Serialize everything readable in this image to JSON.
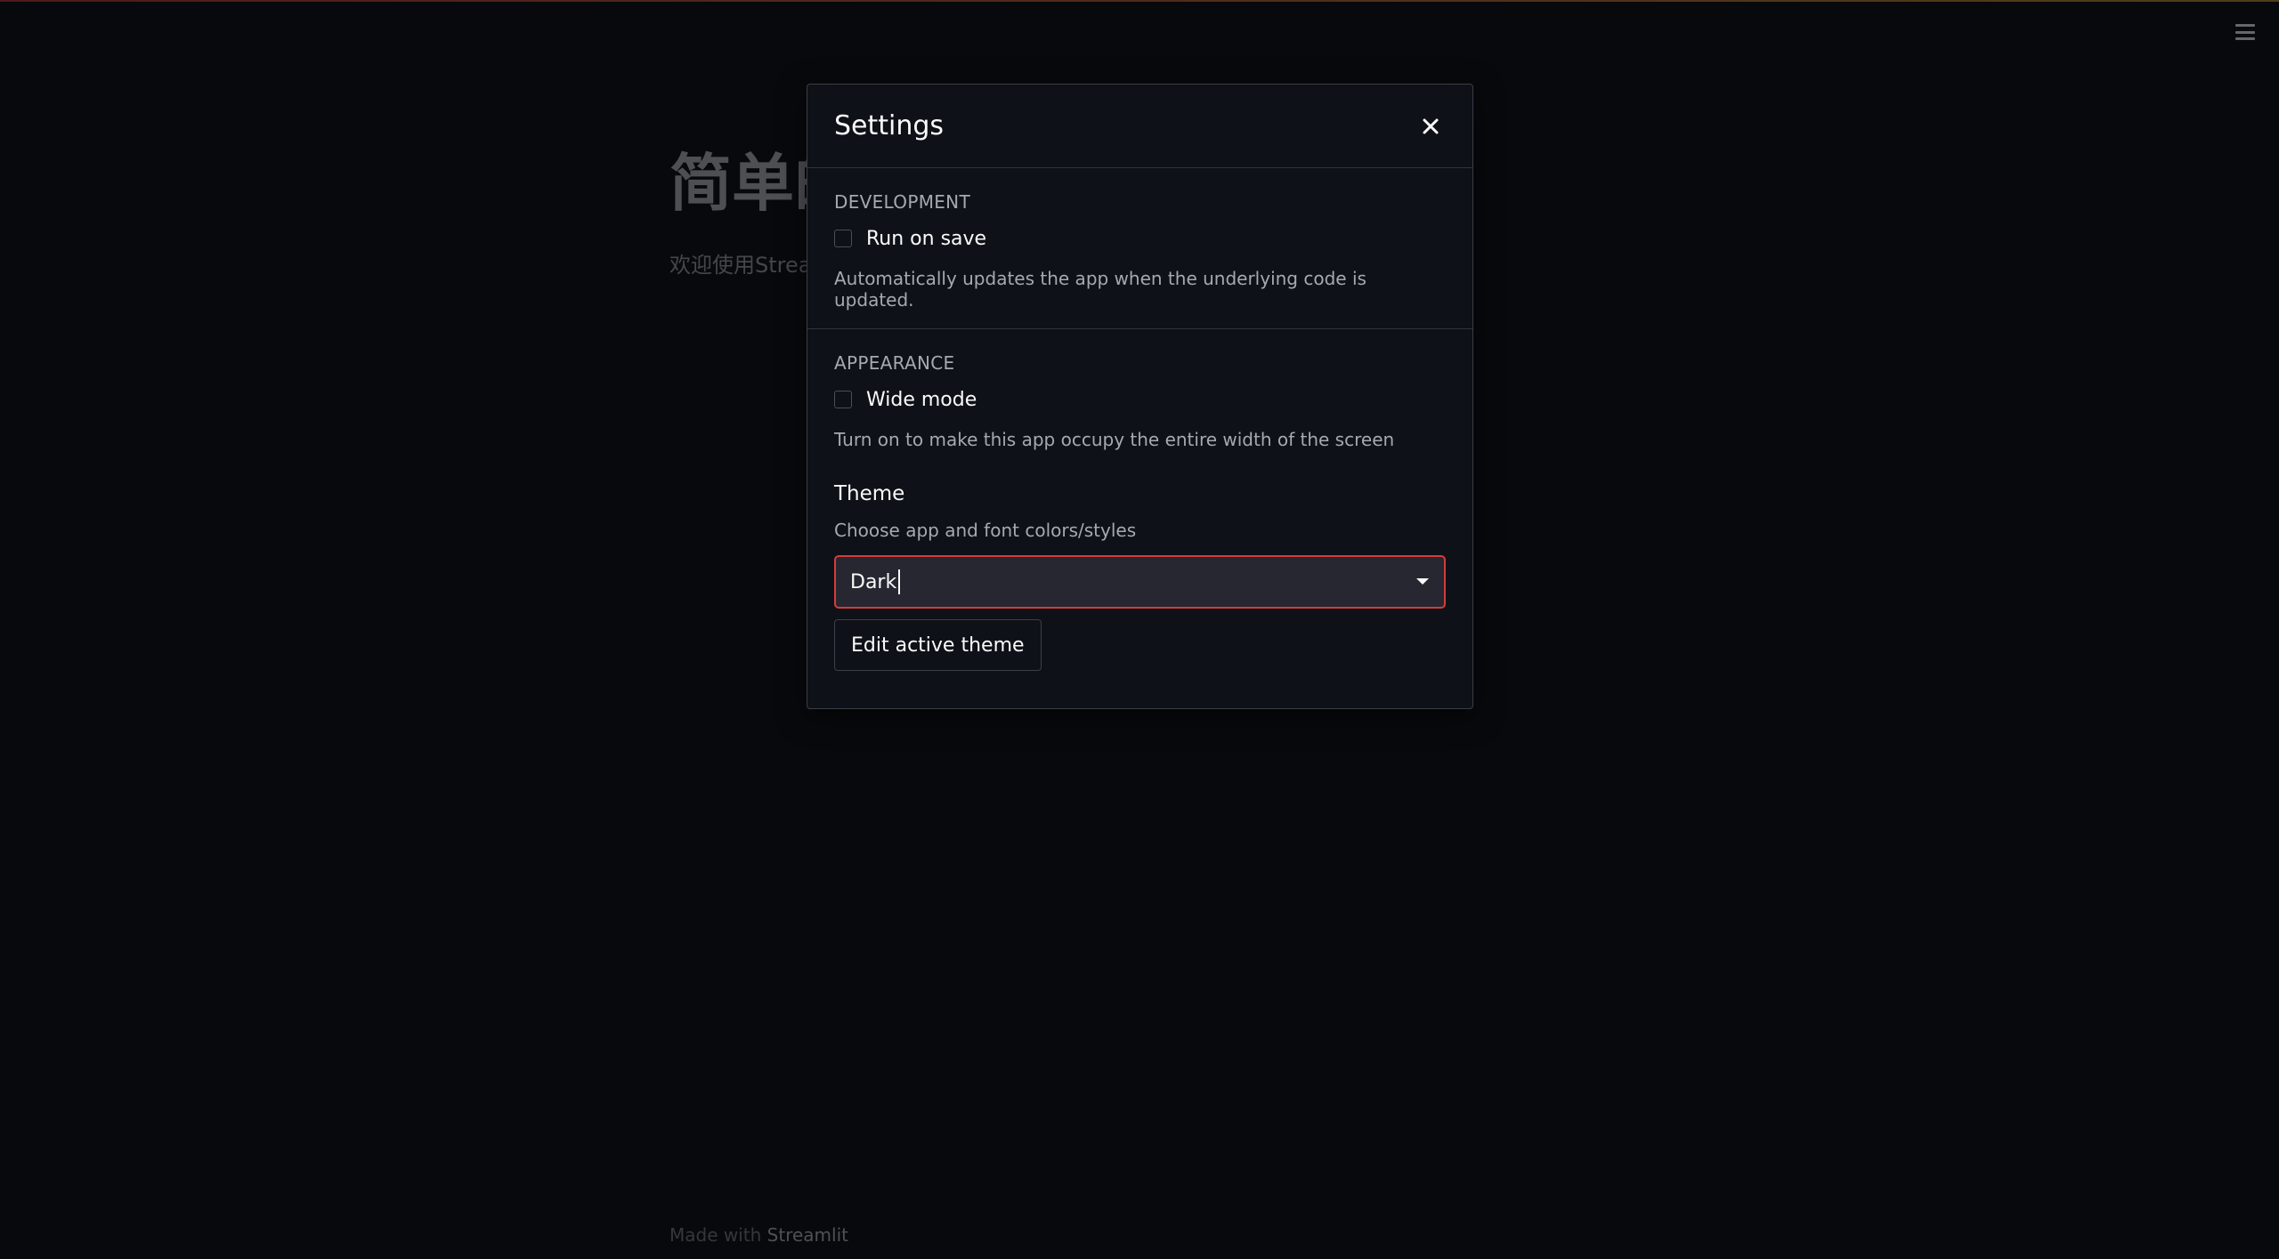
{
  "app": {
    "title": "简单的",
    "subtitle": "欢迎使用Strear",
    "footer_prefix": "Made with ",
    "footer_brand": "Streamlit"
  },
  "menu": {
    "icon": "hamburger-menu-icon"
  },
  "settings_dialog": {
    "title": "Settings",
    "close_icon": "close-icon",
    "development": {
      "section_label": "DEVELOPMENT",
      "run_on_save": {
        "label": "Run on save",
        "checked": false
      },
      "help": "Automatically updates the app when the underlying code is updated."
    },
    "appearance": {
      "section_label": "APPEARANCE",
      "wide_mode": {
        "label": "Wide mode",
        "checked": false
      },
      "help": "Turn on to make this app occupy the entire width of the screen",
      "theme": {
        "heading": "Theme",
        "help": "Choose app and font colors/styles",
        "selected": "Dark",
        "dropdown_icon": "caret-down-icon"
      },
      "edit_theme_label": "Edit active theme"
    }
  },
  "colors": {
    "background": "#0e1117",
    "select_border_focus": "#d73b3b",
    "text_primary": "#fafafa",
    "text_secondary": "#a6a9b0"
  }
}
